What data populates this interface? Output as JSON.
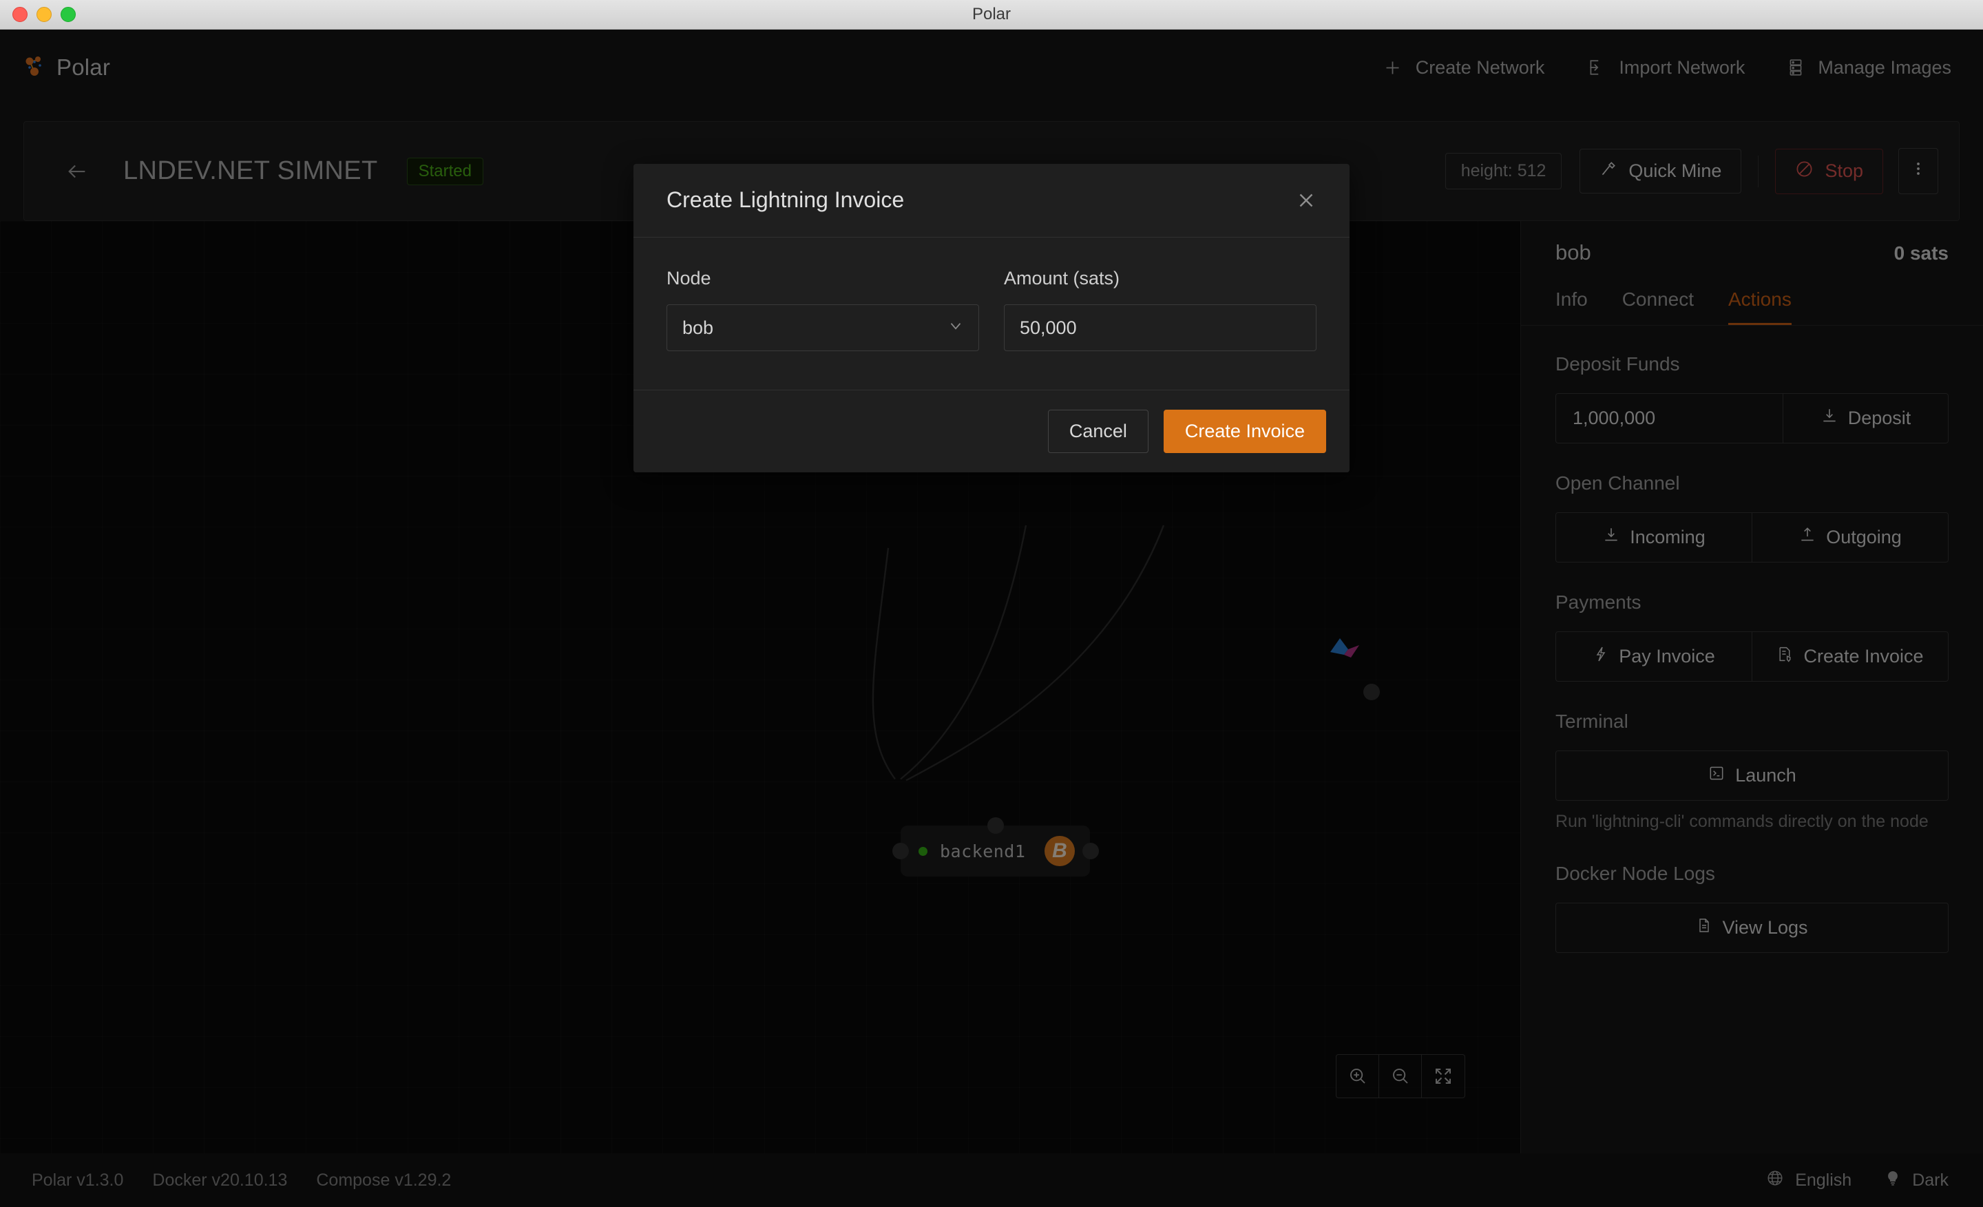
{
  "window": {
    "title": "Polar"
  },
  "header": {
    "brand": "Polar",
    "logo_icon": "polar-molecule-icon",
    "nav": [
      {
        "label": "Create Network",
        "icon": "plus-icon"
      },
      {
        "label": "Import Network",
        "icon": "import-arrow-icon"
      },
      {
        "label": "Manage Images",
        "icon": "server-stack-icon"
      }
    ]
  },
  "network_bar": {
    "back_icon": "arrow-left-icon",
    "title": "LNDEV.NET SIMNET",
    "status_badge": "Started",
    "height_chip": "height: 512",
    "quick_mine": {
      "label": "Quick Mine",
      "icon": "hammer-icon"
    },
    "stop": {
      "label": "Stop",
      "icon": "stop-circle-icon"
    },
    "more_icon": "more-vertical-icon"
  },
  "canvas": {
    "nodes": [
      {
        "name": "backend1",
        "status": "running",
        "coin_icon": "bitcoin-icon"
      }
    ],
    "zoom_controls": [
      {
        "icon": "zoom-in-icon"
      },
      {
        "icon": "zoom-out-icon"
      },
      {
        "icon": "fit-screen-icon"
      }
    ]
  },
  "sidebar": {
    "node_name": "bob",
    "balance": "0 sats",
    "tabs": [
      {
        "label": "Info",
        "active": false
      },
      {
        "label": "Connect",
        "active": false
      },
      {
        "label": "Actions",
        "active": true
      }
    ],
    "sections": {
      "deposit": {
        "label": "Deposit Funds",
        "amount": "1,000,000",
        "button": {
          "label": "Deposit",
          "icon": "download-icon"
        }
      },
      "open_channel": {
        "label": "Open Channel",
        "incoming": {
          "label": "Incoming",
          "icon": "download-icon"
        },
        "outgoing": {
          "label": "Outgoing",
          "icon": "upload-icon"
        }
      },
      "payments": {
        "label": "Payments",
        "pay": {
          "label": "Pay Invoice",
          "icon": "lightning-bolt-icon"
        },
        "create": {
          "label": "Create Invoice",
          "icon": "invoice-icon"
        }
      },
      "terminal": {
        "label": "Terminal",
        "launch": {
          "label": "Launch",
          "icon": "console-icon"
        },
        "hint": "Run 'lightning-cli' commands directly on the node"
      },
      "logs": {
        "label": "Docker Node Logs",
        "view": {
          "label": "View Logs",
          "icon": "file-text-icon"
        }
      }
    }
  },
  "footer": {
    "versions": [
      "Polar v1.3.0",
      "Docker v20.10.13",
      "Compose v1.29.2"
    ],
    "language": {
      "label": "English",
      "icon": "globe-icon"
    },
    "theme": {
      "label": "Dark",
      "icon": "lightbulb-icon"
    }
  },
  "modal": {
    "title": "Create Lightning Invoice",
    "close_icon": "close-icon",
    "node_field": {
      "label": "Node",
      "value": "bob",
      "chevron_icon": "chevron-down-icon"
    },
    "amount_field": {
      "label": "Amount (sats)",
      "value": "50,000",
      "placeholder": ""
    },
    "cancel_label": "Cancel",
    "submit_label": "Create Invoice"
  },
  "colors": {
    "accent": "#d97316",
    "active_tab": "#c45c14",
    "success": "#49aa19",
    "danger": "#d4504e",
    "bitcoin": "#cf7620"
  }
}
